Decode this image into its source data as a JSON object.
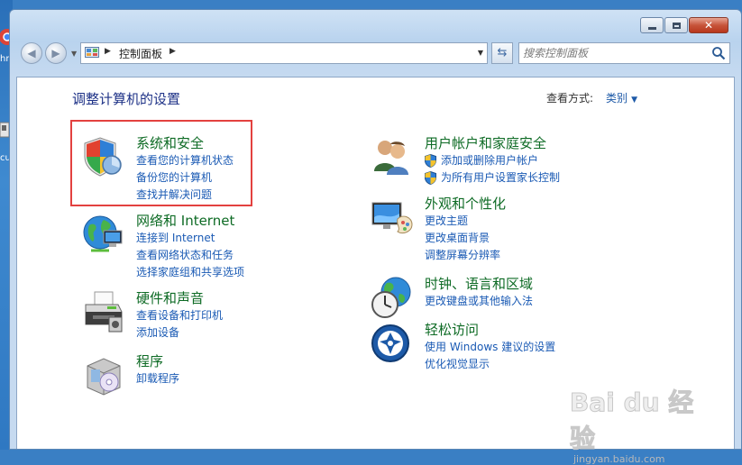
{
  "desktop": {
    "icon_texts": [
      "hr",
      "cu"
    ]
  },
  "window": {
    "buttons": {
      "minimize": "",
      "maximize": "",
      "close": "✕"
    }
  },
  "nav": {
    "back_icon": "back-arrow-icon",
    "forward_icon": "forward-arrow-icon",
    "breadcrumb": "控制面板",
    "search_placeholder": "搜索控制面板"
  },
  "main": {
    "title": "调整计算机的设置",
    "view_by_label": "查看方式:",
    "view_by_value": "类别",
    "highlight_color": "#e3413f"
  },
  "categories": [
    {
      "heading": "系统和安全",
      "icon": "system-security-shield-icon",
      "links": [
        "查看您的计算机状态",
        "备份您的计算机",
        "查找并解决问题"
      ]
    },
    {
      "heading": "网络和 Internet",
      "icon": "network-globe-icon",
      "links": [
        "连接到 Internet",
        "查看网络状态和任务",
        "选择家庭组和共享选项"
      ]
    },
    {
      "heading": "硬件和声音",
      "icon": "printer-icon",
      "links": [
        "查看设备和打印机",
        "添加设备"
      ]
    },
    {
      "heading": "程序",
      "icon": "programs-box-icon",
      "links": [
        "卸载程序"
      ]
    },
    {
      "heading": "用户帐户和家庭安全",
      "icon": "users-icon",
      "links": [
        "添加或删除用户帐户",
        "为所有用户设置家长控制"
      ]
    },
    {
      "heading": "外观和个性化",
      "icon": "monitor-palette-icon",
      "links": [
        "更改主题",
        "更改桌面背景",
        "调整屏幕分辨率"
      ]
    },
    {
      "heading": "时钟、语言和区域",
      "icon": "clock-globe-icon",
      "links": [
        "更改键盘或其他输入法"
      ]
    },
    {
      "heading": "轻松访问",
      "icon": "ease-of-access-icon",
      "links": [
        "使用 Windows 建议的设置",
        "优化视觉显示"
      ]
    }
  ],
  "watermark": {
    "main": "Bai du 经验",
    "sub": "jingyan.baidu.com"
  }
}
